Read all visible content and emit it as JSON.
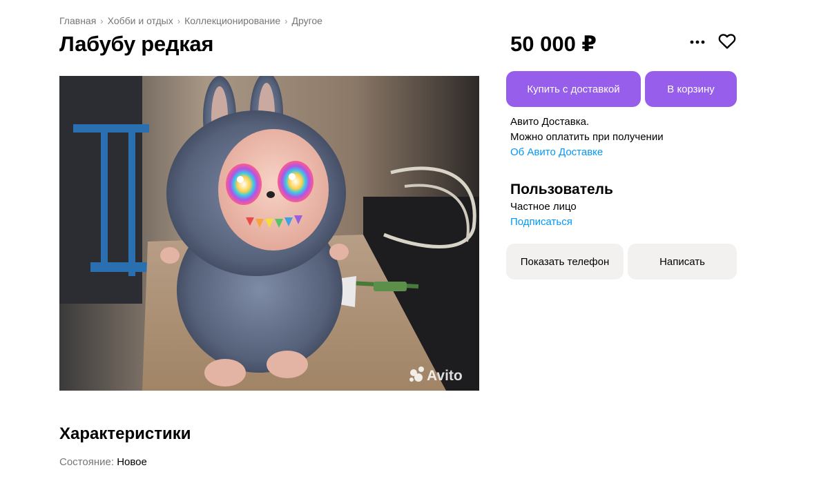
{
  "breadcrumbs": [
    "Главная",
    "Хобби и отдых",
    "Коллекционирование",
    "Другое"
  ],
  "listing": {
    "title": "Лабубу редкая",
    "price": "50 000 ₽",
    "photo_watermark": "Avito"
  },
  "actions": {
    "buy_with_delivery": "Купить с доставкой",
    "add_to_cart": "В корзину",
    "more_icon": "more-dots-icon",
    "favorite_icon": "heart-icon"
  },
  "delivery": {
    "line1": "Авито Доставка.",
    "line2": "Можно оплатить при получении",
    "link": "Об Авито Доставке"
  },
  "seller": {
    "name": "Пользователь",
    "type": "Частное лицо",
    "subscribe": "Подписаться"
  },
  "contact": {
    "show_phone": "Показать телефон",
    "write": "Написать"
  },
  "specs": {
    "title": "Характеристики",
    "items": [
      {
        "key": "Состояние:",
        "value": "Новое"
      }
    ]
  },
  "colors": {
    "accent_purple": "#965eeb",
    "link_blue": "#0099f7",
    "muted_text": "#757575",
    "grey_button": "#f2f1f0"
  }
}
